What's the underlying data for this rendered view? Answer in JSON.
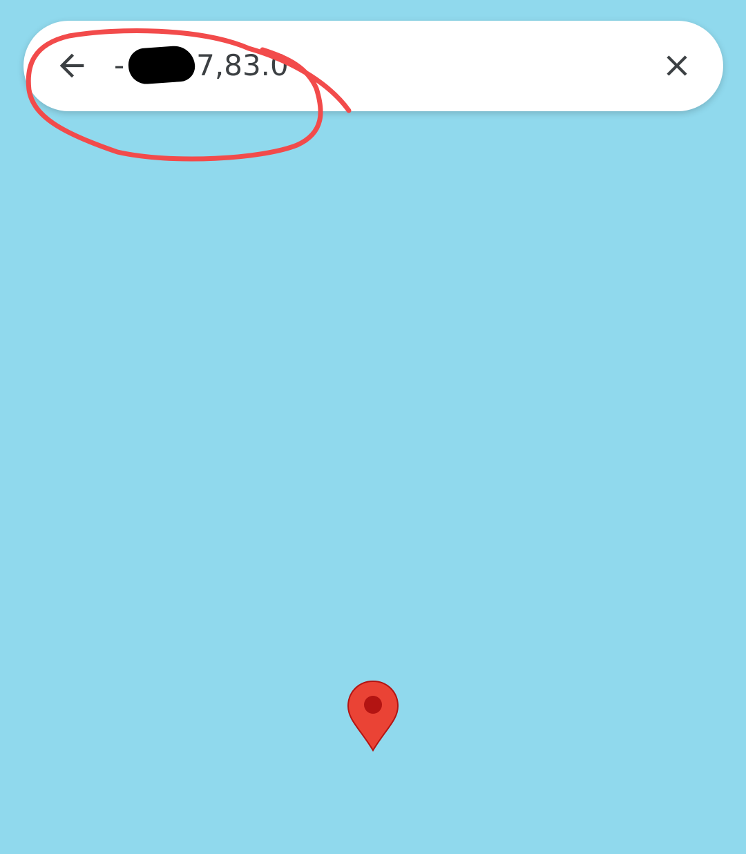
{
  "search": {
    "query_prefix": "-",
    "query_visible_suffix": "7,83.0"
  },
  "icons": {
    "back": "arrow-back-icon",
    "clear": "close-icon",
    "pin": "map-pin-icon"
  },
  "colors": {
    "water": "#90d9ed",
    "search_bg": "#ffffff",
    "text": "#3c4043",
    "annotation": "#f24b4b",
    "pin_fill": "#ea4335",
    "pin_center": "#b31412"
  }
}
